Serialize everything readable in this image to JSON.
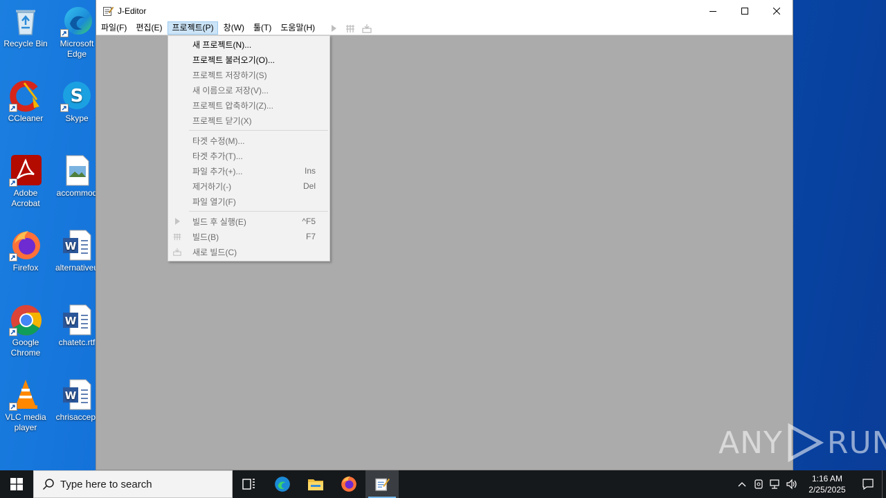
{
  "desktop": {
    "icons": [
      {
        "name": "recycle-bin",
        "label": "Recycle Bin",
        "icon": "recycle-bin-icon"
      },
      {
        "name": "microsoft-edge",
        "label": "Microsoft Edge",
        "icon": "edge-icon"
      },
      {
        "name": "ccleaner",
        "label": "CCleaner",
        "icon": "ccleaner-icon"
      },
      {
        "name": "skype",
        "label": "Skype",
        "icon": "skype-icon"
      },
      {
        "name": "adobe-acrobat",
        "label": "Adobe Acrobat",
        "icon": "acrobat-icon"
      },
      {
        "name": "accommod",
        "label": "accommod",
        "icon": "image-file-icon"
      },
      {
        "name": "firefox",
        "label": "Firefox",
        "icon": "firefox-icon"
      },
      {
        "name": "alternativeu",
        "label": "alternativeu",
        "icon": "word-doc-icon"
      },
      {
        "name": "google-chrome",
        "label": "Google Chrome",
        "icon": "chrome-icon"
      },
      {
        "name": "chatetc",
        "label": "chatetc.rtf",
        "icon": "word-doc-icon"
      },
      {
        "name": "vlc",
        "label": "VLC media player",
        "icon": "vlc-icon"
      },
      {
        "name": "chrisaccep",
        "label": "chrisaccep.",
        "icon": "word-doc-icon"
      }
    ]
  },
  "window": {
    "title": "J-Editor",
    "controls": {
      "minimize": "minimize",
      "maximize": "maximize",
      "close": "close"
    }
  },
  "menubar": {
    "items": [
      "파일(F)",
      "편집(E)",
      "프로젝트(P)",
      "창(W)",
      "툴(T)",
      "도움말(H)"
    ],
    "active_index": 2
  },
  "project_menu": {
    "group1": [
      {
        "label": "새 프로젝트(N)...",
        "enabled": true
      },
      {
        "label": "프로젝트 불러오기(O)...",
        "enabled": true
      },
      {
        "label": "프로젝트 저장하기(S)",
        "enabled": false
      },
      {
        "label": "새 이름으로 저장(V)...",
        "enabled": false
      },
      {
        "label": "프로젝트 압축하기(Z)...",
        "enabled": false
      },
      {
        "label": "프로젝트 닫기(X)",
        "enabled": false
      }
    ],
    "group2": [
      {
        "label": "타겟 수정(M)...",
        "shortcut": "",
        "enabled": false
      },
      {
        "label": "타겟 추가(T)...",
        "shortcut": "",
        "enabled": false
      },
      {
        "label": "파일 추가(+)...",
        "shortcut": "Ins",
        "enabled": false
      },
      {
        "label": "제거하기(-)",
        "shortcut": "Del",
        "enabled": false
      },
      {
        "label": "파일 열기(F)",
        "shortcut": "",
        "enabled": false
      }
    ],
    "group3": [
      {
        "label": "빌드 후 실행(E)",
        "shortcut": "^F5",
        "enabled": false,
        "icon": "run-icon"
      },
      {
        "label": "빌드(B)",
        "shortcut": "F7",
        "enabled": false,
        "icon": "build-icon"
      },
      {
        "label": "새로 빌드(C)",
        "shortcut": "",
        "enabled": false,
        "icon": "rebuild-icon"
      }
    ]
  },
  "watermark": {
    "text_left": "ANY",
    "text_right": "RUN"
  },
  "taskbar": {
    "search_placeholder": "Type here to search",
    "clock_time": "1:16 AM",
    "clock_date": "2/25/2025"
  }
}
